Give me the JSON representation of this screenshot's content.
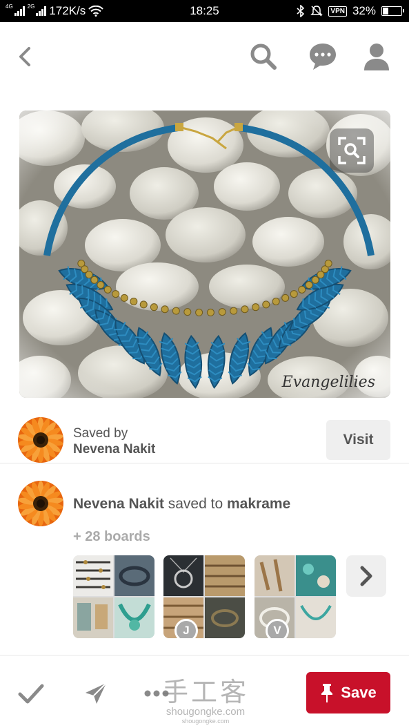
{
  "status_bar": {
    "network": "4G",
    "network2": "2G",
    "speed": "172K/s",
    "time": "18:25",
    "vpn": "VPN",
    "battery": "32%",
    "battery_level": 0.32
  },
  "icons": {
    "back": "chevron-left-icon",
    "search": "search-icon",
    "messages": "chat-bubble-icon",
    "profile": "person-icon",
    "zoom": "visual-search-icon",
    "done": "checkmark-icon",
    "send": "send-icon",
    "more": "more-dots-icon",
    "pin": "pushpin-icon",
    "next": "chevron-right-icon"
  },
  "pin": {
    "image_watermark": "Evangelilies"
  },
  "saved_by": {
    "label": "Saved by",
    "name": "Nevena Nakit",
    "visit_label": "Visit"
  },
  "saved_to": {
    "name": "Nevena Nakit",
    "connector": "saved to",
    "board": "makrame",
    "more_boards": "+ 28 boards",
    "boards": [
      {
        "badge": ""
      },
      {
        "badge": "J"
      },
      {
        "badge": "V"
      }
    ]
  },
  "bottom_bar": {
    "save_label": "Save",
    "site_watermark_big": "手工客",
    "site_watermark_small": "shougongke.com",
    "site_watermark_tiny": "shougongke.com"
  },
  "colors": {
    "save_red": "#c8112a",
    "gray_text": "#555555",
    "muted_text": "#aaaaaa",
    "necklace_blue": "#1f6f9e"
  }
}
